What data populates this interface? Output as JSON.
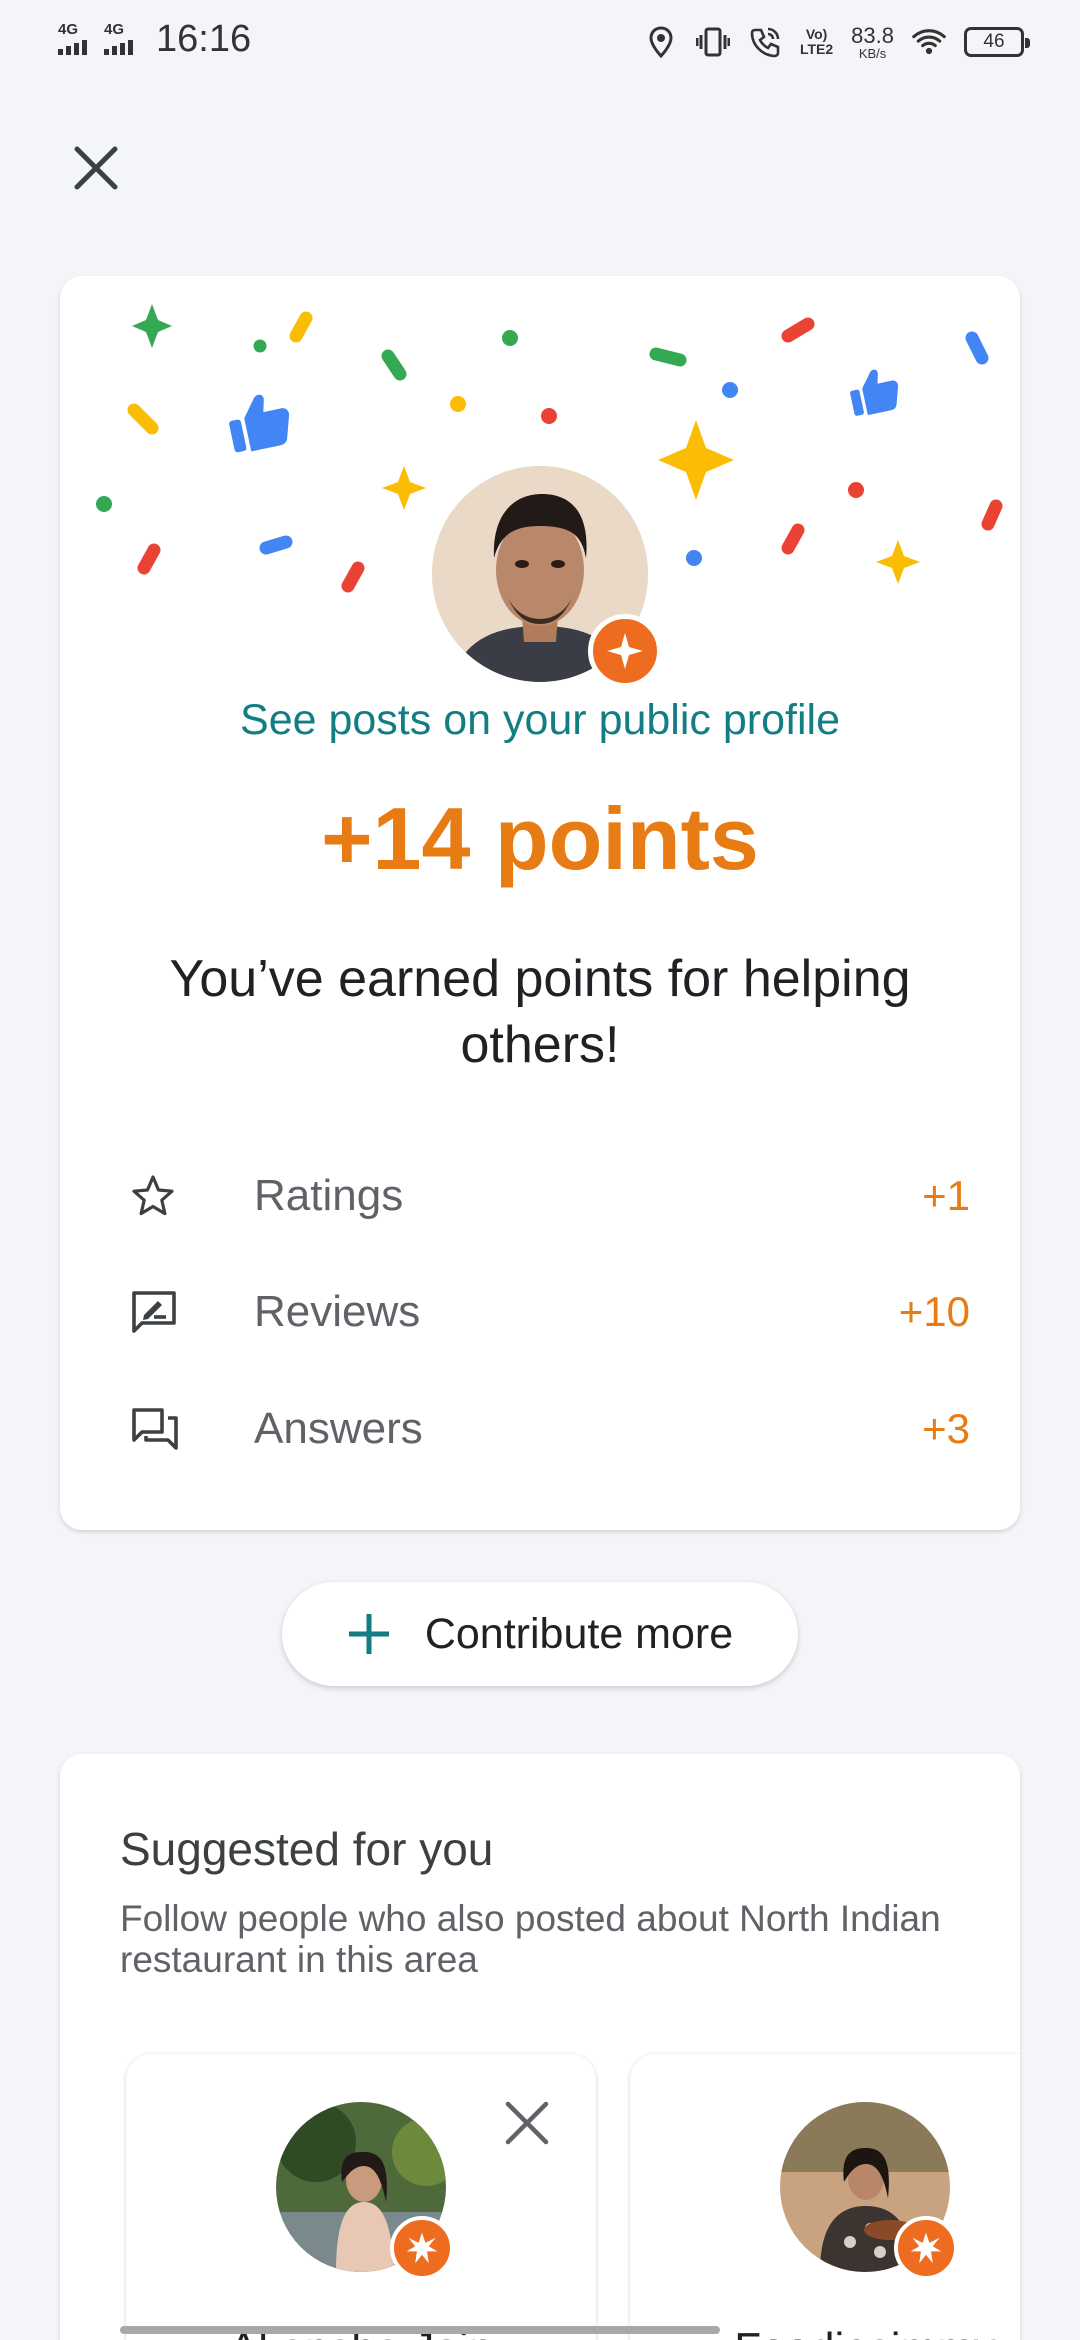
{
  "status_bar": {
    "network_1": "4G",
    "network_2": "4G",
    "time": "16:16",
    "volte_line1": "Vo)",
    "volte_line2": "LTE2",
    "speed_value": "83.8",
    "speed_unit": "KB/s",
    "battery": "46",
    "icons": [
      "location-icon",
      "vibrate-icon",
      "wifi-calling-icon",
      "wifi-icon",
      "battery-icon"
    ]
  },
  "close_icon": "close-icon",
  "card": {
    "profile_link": "See posts on your public profile",
    "points": "+14 points",
    "earned_message": "You’ve earned points for helping others!",
    "rows": [
      {
        "icon": "star-outline-icon",
        "label": "Ratings",
        "value": "+1"
      },
      {
        "icon": "review-icon",
        "label": "Reviews",
        "value": "+10"
      },
      {
        "icon": "answers-icon",
        "label": "Answers",
        "value": "+3"
      }
    ]
  },
  "contribute": {
    "icon": "plus-icon",
    "label": "Contribute more"
  },
  "suggested": {
    "title": "Suggested for you",
    "description": "Follow people who also posted about North Indian restaurant in this area",
    "people": [
      {
        "name": "Akansha Jain"
      },
      {
        "name": "Foodiesimmy"
      }
    ]
  },
  "colors": {
    "accent_teal": "#127e83",
    "points_orange": "#e67c13",
    "badge_orange": "#ee6c1f",
    "background": "#f4f5f9"
  }
}
